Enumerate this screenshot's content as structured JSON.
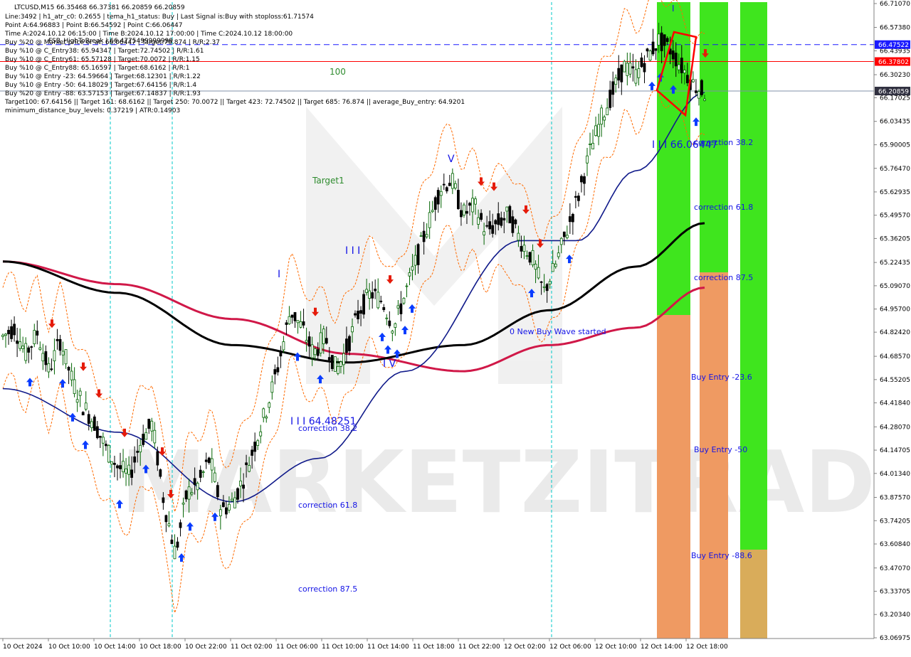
{
  "symbol_header": "LTCUSD,M15  66.35468 66.37381 66.20859 66.20859",
  "info_lines": [
    "Line:3492 | h1_atr_c0: 0.2655 | tema_h1_status: Buy | Last Signal is:Buy with stoploss:61.71574",
    "Point A:64.96883 | Point B:66.54592 | Point C:66.06447",
    "Time A:2024.10.12 06:15:00 | Time B:2024.10.12 17:00:00 | Time C:2024.10.12 18:00:00",
    "Buy %20 @ Market price or at: 66.06447 | Target:76.874 | R/R:2.37",
    "Buy %10 @ C_Entry38: 65.94347 | Target:72.74502 | R/R:1.61",
    "Buy %10 @ C_Entry61: 65.57128 | Target:70.0072 | R/R:1.15",
    "Buy %10 @ C_Entry88: 65.16597 | Target:68.6162 | R/R:1",
    "Buy %10 @ Entry -23: 64.59664 | Target:68.12301 | R/R:1.22",
    "Buy %10 @ Entry -50: 64.18029 | Target:67.64156 | R/R:1.4",
    "Buy %20 @ Entry -88: 63.57153 | Target:67.14837 | R/R:1.93",
    "Target100: 67.64156 || Target 161: 68.6162 || Target 250: 70.0072 || Target 423: 72.74502 || Target 685: 76.874 || average_Buy_entry: 64.9201",
    "minimum_distance_buy_levels: 0.37219 | ATR:0.14903"
  ],
  "overlay_text": "FSB_HighToBreak | 66.4775499999999",
  "watermark": "MARKETZITRADE",
  "colors": {
    "background": "#ffffff",
    "bull_candle": "#006400",
    "bear_candle": "#000000",
    "ma_black": "#000000",
    "ma_red": "#d01848",
    "ma_navy": "#101a8a",
    "envelope_orange": "#ff6a00",
    "zone_green": "#3fe51e",
    "zone_orange": "#ef9a62",
    "zone_tan": "#d9ac5a",
    "buy_arrow": "#0a3cff",
    "sell_arrow": "#e51b0a",
    "time_sep": "#00c8c8",
    "blue_dashed_line": "#1a1aff",
    "red_line": "#ff0000",
    "label_blue": "#1414e6",
    "label_green": "#2e8b2e"
  },
  "price_tags": [
    {
      "price": 66.47522,
      "text": "66.47522",
      "color": "#1a1aff"
    },
    {
      "price": 66.37802,
      "text": "66.37802",
      "color": "#ff0000"
    },
    {
      "price": 66.20859,
      "text": "66.20859",
      "color": "#303040"
    }
  ],
  "chart_data": {
    "type": "candlestick",
    "y_range": [
      63.0697,
      66.7107
    ],
    "x_labels": [
      "10 Oct 2024",
      "10 Oct 10:00",
      "10 Oct 14:00",
      "10 Oct 18:00",
      "10 Oct 22:00",
      "11 Oct 02:00",
      "11 Oct 06:00",
      "11 Oct 10:00",
      "11 Oct 14:00",
      "11 Oct 18:00",
      "11 Oct 22:00",
      "12 Oct 02:00",
      "12 Oct 06:00",
      "12 Oct 10:00",
      "12 Oct 14:00",
      "12 Oct 18:00"
    ],
    "y_ticks": [
      "66.71070",
      "66.57380",
      "66.43935",
      "66.30230",
      "66.17025",
      "66.03435",
      "65.90005",
      "65.76470",
      "65.62935",
      "65.49570",
      "65.36205",
      "65.22435",
      "65.09070",
      "64.95700",
      "64.82420",
      "64.68570",
      "64.55205",
      "64.41840",
      "64.28070",
      "64.14705",
      "64.01340",
      "63.87570",
      "63.74205",
      "63.60840",
      "63.47070",
      "63.33705",
      "63.20340",
      "63.06975"
    ],
    "price_path": [
      [
        0,
        64.8
      ],
      [
        2,
        64.85
      ],
      [
        4,
        64.7
      ],
      [
        6,
        64.82
      ],
      [
        8,
        64.6
      ],
      [
        10,
        64.78
      ],
      [
        12,
        64.55
      ],
      [
        14,
        64.4
      ],
      [
        16,
        64.3
      ],
      [
        18,
        64.15
      ],
      [
        20,
        64.05
      ],
      [
        22,
        64.0
      ],
      [
        24,
        64.2
      ],
      [
        26,
        64.3
      ],
      [
        28,
        63.85
      ],
      [
        30,
        63.55
      ],
      [
        32,
        63.9
      ],
      [
        34,
        63.95
      ],
      [
        36,
        64.1
      ],
      [
        38,
        63.8
      ],
      [
        40,
        63.85
      ],
      [
        42,
        64.0
      ],
      [
        44,
        64.2
      ],
      [
        46,
        64.4
      ],
      [
        48,
        64.65
      ],
      [
        50,
        64.95
      ],
      [
        52,
        64.85
      ],
      [
        54,
        64.7
      ],
      [
        56,
        64.8
      ],
      [
        58,
        64.6
      ],
      [
        60,
        64.75
      ],
      [
        62,
        64.95
      ],
      [
        64,
        65.05
      ],
      [
        66,
        65.0
      ],
      [
        68,
        64.85
      ],
      [
        70,
        65.05
      ],
      [
        72,
        65.25
      ],
      [
        74,
        65.45
      ],
      [
        76,
        65.65
      ],
      [
        78,
        65.7
      ],
      [
        80,
        65.5
      ],
      [
        82,
        65.55
      ],
      [
        84,
        65.4
      ],
      [
        86,
        65.45
      ],
      [
        88,
        65.5
      ],
      [
        90,
        65.35
      ],
      [
        92,
        65.25
      ],
      [
        94,
        65.05
      ],
      [
        96,
        65.2
      ],
      [
        98,
        65.4
      ],
      [
        100,
        65.6
      ],
      [
        102,
        65.85
      ],
      [
        104,
        66.05
      ],
      [
        106,
        66.2
      ],
      [
        108,
        66.35
      ],
      [
        110,
        66.3
      ],
      [
        112,
        66.4
      ],
      [
        114,
        66.5
      ],
      [
        116,
        66.45
      ],
      [
        118,
        66.35
      ],
      [
        120,
        66.25
      ],
      [
        122,
        66.2
      ]
    ],
    "index_range": [
      0,
      122
    ],
    "series": [
      {
        "name": "",
        "values": [
          [
            0,
            65.23
          ],
          [
            20,
            65.1
          ],
          [
            40,
            64.9
          ],
          [
            60,
            64.7
          ],
          [
            80,
            64.6
          ],
          [
            95,
            64.75
          ],
          [
            110,
            64.85
          ],
          [
            122,
            65.08
          ]
        ]
      },
      {
        "name": "",
        "values": [
          [
            0,
            65.23
          ],
          [
            20,
            65.05
          ],
          [
            40,
            64.75
          ],
          [
            60,
            64.65
          ],
          [
            80,
            64.75
          ],
          [
            95,
            64.95
          ],
          [
            110,
            65.2
          ],
          [
            122,
            65.45
          ]
        ]
      },
      {
        "name": "",
        "values": [
          [
            0,
            64.5
          ],
          [
            20,
            64.25
          ],
          [
            40,
            63.85
          ],
          [
            55,
            64.1
          ],
          [
            70,
            64.6
          ],
          [
            90,
            65.35
          ],
          [
            100,
            65.35
          ],
          [
            110,
            65.75
          ],
          [
            122,
            66.2
          ]
        ]
      }
    ],
    "zones": [
      {
        "label": "correction 38.2",
        "kind": "green",
        "price_top": 66.71,
        "price_bottom": 64.91
      },
      {
        "label": "Buy Entry -23.6",
        "kind": "orange",
        "price_top": 64.91,
        "price_bottom": 63.07
      }
    ],
    "labels": [
      {
        "text": "100",
        "color": "green"
      },
      {
        "text": "Target1",
        "color": "green"
      },
      {
        "text": "I",
        "color": "blue"
      },
      {
        "text": "V",
        "color": "blue"
      },
      {
        "text": "I I I",
        "color": "blue"
      },
      {
        "text": "I V",
        "color": "blue"
      },
      {
        "text": "I I I 64.48251",
        "color": "blue"
      },
      {
        "text": "correction 38.2",
        "color": "blue"
      },
      {
        "text": "correction 61.8",
        "color": "blue"
      },
      {
        "text": "correction 87.5",
        "color": "blue"
      },
      {
        "text": "0 New Buy Wave started",
        "color": "blue"
      },
      {
        "text": "I I I 66.06447",
        "color": "blue"
      },
      {
        "text": "correction 61.8",
        "color": "blue"
      },
      {
        "text": "correction 87.5",
        "color": "blue"
      },
      {
        "text": "Buy Entry -23.6",
        "color": "blue"
      },
      {
        "text": "Buy Entry -50",
        "color": "blue"
      },
      {
        "text": "Buy Entry -88.6",
        "color": "blue"
      }
    ]
  }
}
